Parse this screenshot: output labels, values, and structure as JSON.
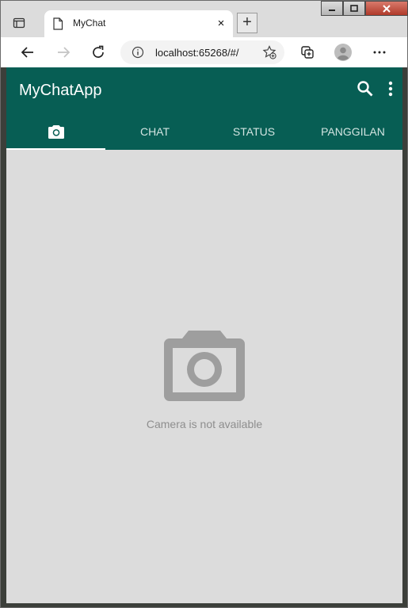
{
  "browser": {
    "tab_title": "MyChat",
    "tab_close": "×",
    "new_tab": "+",
    "address_url": "localhost:65268/#/"
  },
  "app": {
    "title": "MyChatApp",
    "tabs": [
      {
        "id": "camera",
        "label": "",
        "icon": "camera-icon",
        "active": true
      },
      {
        "id": "chat",
        "label": "CHAT",
        "active": false
      },
      {
        "id": "status",
        "label": "STATUS",
        "active": false
      },
      {
        "id": "calls",
        "label": "PANGGILAN",
        "active": false
      }
    ],
    "header_icons": [
      "search-icon",
      "more-vert-icon"
    ],
    "camera_message": "Camera is not available"
  },
  "colors": {
    "primary": "#075e54",
    "content_bg": "#dcdcdc",
    "muted": "#8e8e8e"
  }
}
